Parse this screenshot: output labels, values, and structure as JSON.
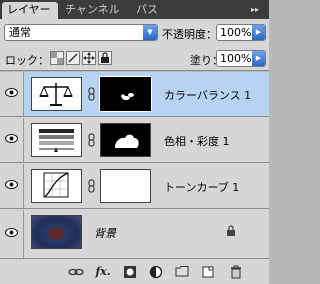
{
  "tabs": [
    {
      "label": "レイヤー"
    },
    {
      "label": "チャンネル"
    },
    {
      "label": "パス"
    }
  ],
  "tab_close_glyph": "×",
  "panel_menu_glyph": "▸▸",
  "blend_mode": "通常",
  "opacity": {
    "label": "不透明度：",
    "value": "100%"
  },
  "lock": {
    "label": "ロック："
  },
  "fill": {
    "label": "塗り：",
    "value": "100%"
  },
  "layers": [
    {
      "name": "カラーバランス 1",
      "selected": true,
      "adjustment": "color-balance-icon"
    },
    {
      "name": "色相・彩度 1",
      "selected": false,
      "adjustment": "hue-saturation-icon"
    },
    {
      "name": "トーンカーブ 1",
      "selected": false,
      "adjustment": "curves-icon"
    },
    {
      "name": "背景",
      "selected": false,
      "background": true
    }
  ],
  "colors": {
    "tabbar": "#3c3c3c",
    "panel": "#d6d6d6",
    "selected_row": "#b6d4f2",
    "accent_blue": "#2a66c8"
  }
}
